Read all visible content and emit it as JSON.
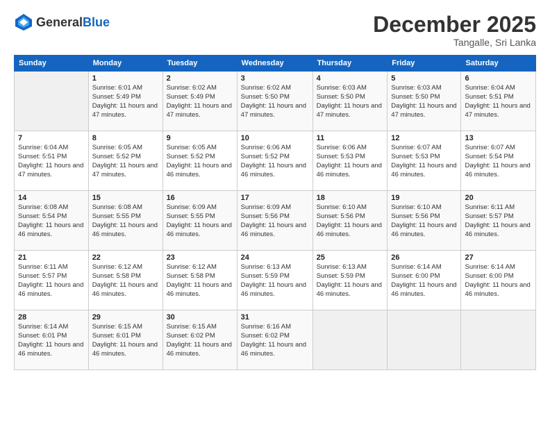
{
  "header": {
    "logo_general": "General",
    "logo_blue": "Blue",
    "month": "December 2025",
    "location": "Tangalle, Sri Lanka"
  },
  "days_of_week": [
    "Sunday",
    "Monday",
    "Tuesday",
    "Wednesday",
    "Thursday",
    "Friday",
    "Saturday"
  ],
  "weeks": [
    [
      {
        "day": "",
        "sunrise": "",
        "sunset": "",
        "daylight": ""
      },
      {
        "day": "1",
        "sunrise": "Sunrise: 6:01 AM",
        "sunset": "Sunset: 5:49 PM",
        "daylight": "Daylight: 11 hours and 47 minutes."
      },
      {
        "day": "2",
        "sunrise": "Sunrise: 6:02 AM",
        "sunset": "Sunset: 5:49 PM",
        "daylight": "Daylight: 11 hours and 47 minutes."
      },
      {
        "day": "3",
        "sunrise": "Sunrise: 6:02 AM",
        "sunset": "Sunset: 5:50 PM",
        "daylight": "Daylight: 11 hours and 47 minutes."
      },
      {
        "day": "4",
        "sunrise": "Sunrise: 6:03 AM",
        "sunset": "Sunset: 5:50 PM",
        "daylight": "Daylight: 11 hours and 47 minutes."
      },
      {
        "day": "5",
        "sunrise": "Sunrise: 6:03 AM",
        "sunset": "Sunset: 5:50 PM",
        "daylight": "Daylight: 11 hours and 47 minutes."
      },
      {
        "day": "6",
        "sunrise": "Sunrise: 6:04 AM",
        "sunset": "Sunset: 5:51 PM",
        "daylight": "Daylight: 11 hours and 47 minutes."
      }
    ],
    [
      {
        "day": "7",
        "sunrise": "Sunrise: 6:04 AM",
        "sunset": "Sunset: 5:51 PM",
        "daylight": "Daylight: 11 hours and 47 minutes."
      },
      {
        "day": "8",
        "sunrise": "Sunrise: 6:05 AM",
        "sunset": "Sunset: 5:52 PM",
        "daylight": "Daylight: 11 hours and 47 minutes."
      },
      {
        "day": "9",
        "sunrise": "Sunrise: 6:05 AM",
        "sunset": "Sunset: 5:52 PM",
        "daylight": "Daylight: 11 hours and 46 minutes."
      },
      {
        "day": "10",
        "sunrise": "Sunrise: 6:06 AM",
        "sunset": "Sunset: 5:52 PM",
        "daylight": "Daylight: 11 hours and 46 minutes."
      },
      {
        "day": "11",
        "sunrise": "Sunrise: 6:06 AM",
        "sunset": "Sunset: 5:53 PM",
        "daylight": "Daylight: 11 hours and 46 minutes."
      },
      {
        "day": "12",
        "sunrise": "Sunrise: 6:07 AM",
        "sunset": "Sunset: 5:53 PM",
        "daylight": "Daylight: 11 hours and 46 minutes."
      },
      {
        "day": "13",
        "sunrise": "Sunrise: 6:07 AM",
        "sunset": "Sunset: 5:54 PM",
        "daylight": "Daylight: 11 hours and 46 minutes."
      }
    ],
    [
      {
        "day": "14",
        "sunrise": "Sunrise: 6:08 AM",
        "sunset": "Sunset: 5:54 PM",
        "daylight": "Daylight: 11 hours and 46 minutes."
      },
      {
        "day": "15",
        "sunrise": "Sunrise: 6:08 AM",
        "sunset": "Sunset: 5:55 PM",
        "daylight": "Daylight: 11 hours and 46 minutes."
      },
      {
        "day": "16",
        "sunrise": "Sunrise: 6:09 AM",
        "sunset": "Sunset: 5:55 PM",
        "daylight": "Daylight: 11 hours and 46 minutes."
      },
      {
        "day": "17",
        "sunrise": "Sunrise: 6:09 AM",
        "sunset": "Sunset: 5:56 PM",
        "daylight": "Daylight: 11 hours and 46 minutes."
      },
      {
        "day": "18",
        "sunrise": "Sunrise: 6:10 AM",
        "sunset": "Sunset: 5:56 PM",
        "daylight": "Daylight: 11 hours and 46 minutes."
      },
      {
        "day": "19",
        "sunrise": "Sunrise: 6:10 AM",
        "sunset": "Sunset: 5:56 PM",
        "daylight": "Daylight: 11 hours and 46 minutes."
      },
      {
        "day": "20",
        "sunrise": "Sunrise: 6:11 AM",
        "sunset": "Sunset: 5:57 PM",
        "daylight": "Daylight: 11 hours and 46 minutes."
      }
    ],
    [
      {
        "day": "21",
        "sunrise": "Sunrise: 6:11 AM",
        "sunset": "Sunset: 5:57 PM",
        "daylight": "Daylight: 11 hours and 46 minutes."
      },
      {
        "day": "22",
        "sunrise": "Sunrise: 6:12 AM",
        "sunset": "Sunset: 5:58 PM",
        "daylight": "Daylight: 11 hours and 46 minutes."
      },
      {
        "day": "23",
        "sunrise": "Sunrise: 6:12 AM",
        "sunset": "Sunset: 5:58 PM",
        "daylight": "Daylight: 11 hours and 46 minutes."
      },
      {
        "day": "24",
        "sunrise": "Sunrise: 6:13 AM",
        "sunset": "Sunset: 5:59 PM",
        "daylight": "Daylight: 11 hours and 46 minutes."
      },
      {
        "day": "25",
        "sunrise": "Sunrise: 6:13 AM",
        "sunset": "Sunset: 5:59 PM",
        "daylight": "Daylight: 11 hours and 46 minutes."
      },
      {
        "day": "26",
        "sunrise": "Sunrise: 6:14 AM",
        "sunset": "Sunset: 6:00 PM",
        "daylight": "Daylight: 11 hours and 46 minutes."
      },
      {
        "day": "27",
        "sunrise": "Sunrise: 6:14 AM",
        "sunset": "Sunset: 6:00 PM",
        "daylight": "Daylight: 11 hours and 46 minutes."
      }
    ],
    [
      {
        "day": "28",
        "sunrise": "Sunrise: 6:14 AM",
        "sunset": "Sunset: 6:01 PM",
        "daylight": "Daylight: 11 hours and 46 minutes."
      },
      {
        "day": "29",
        "sunrise": "Sunrise: 6:15 AM",
        "sunset": "Sunset: 6:01 PM",
        "daylight": "Daylight: 11 hours and 46 minutes."
      },
      {
        "day": "30",
        "sunrise": "Sunrise: 6:15 AM",
        "sunset": "Sunset: 6:02 PM",
        "daylight": "Daylight: 11 hours and 46 minutes."
      },
      {
        "day": "31",
        "sunrise": "Sunrise: 6:16 AM",
        "sunset": "Sunset: 6:02 PM",
        "daylight": "Daylight: 11 hours and 46 minutes."
      },
      {
        "day": "",
        "sunrise": "",
        "sunset": "",
        "daylight": ""
      },
      {
        "day": "",
        "sunrise": "",
        "sunset": "",
        "daylight": ""
      },
      {
        "day": "",
        "sunrise": "",
        "sunset": "",
        "daylight": ""
      }
    ]
  ]
}
